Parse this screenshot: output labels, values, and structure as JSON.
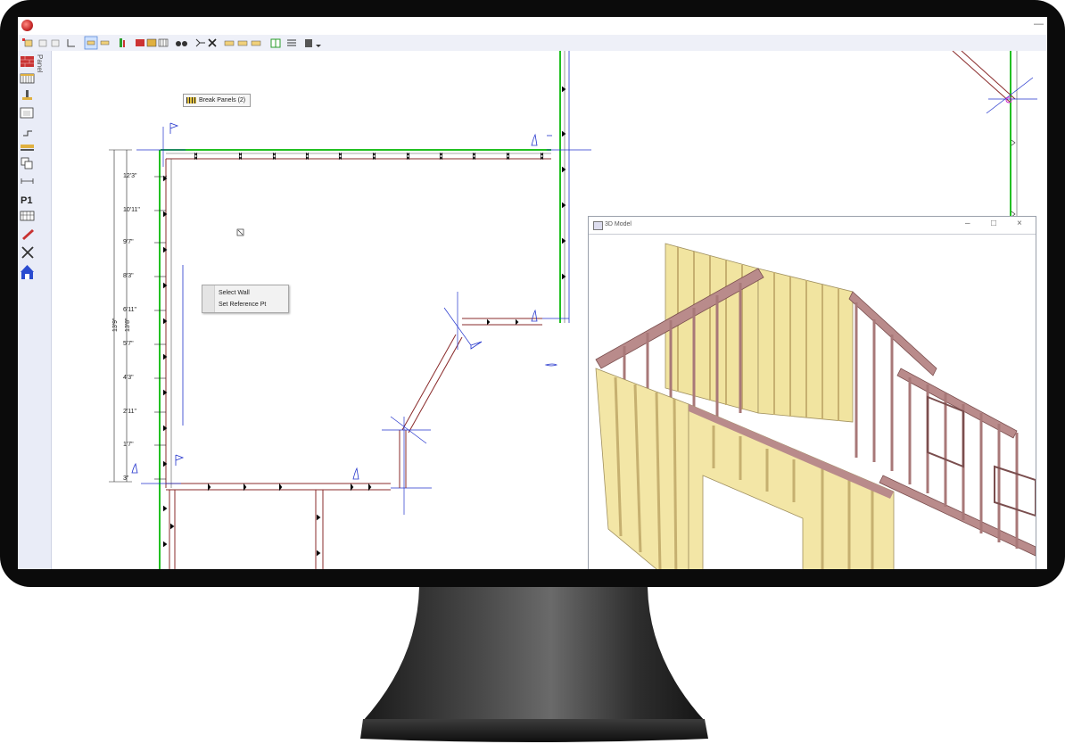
{
  "tooltip": {
    "label": "Break Panels (2)"
  },
  "left_panel": {
    "tab_label": "Panel"
  },
  "context_menu": {
    "items": [
      "Select Wall",
      "Set Reference Pt"
    ]
  },
  "model_window": {
    "title": "3D Model"
  },
  "dimensions": {
    "vertical_total_outer": "13'9\"",
    "vertical_total_inner": "13'8\"",
    "ticks": [
      "12'3\"",
      "10'11\"",
      "9'7\"",
      "8'3\"",
      "6'11\"",
      "5'7\"",
      "4'3\"",
      "2'11\"",
      "1'7\"",
      "3\""
    ]
  },
  "colors": {
    "wall_green": "#22c022",
    "wall_frame": "#8a2b2b",
    "dim_blue": "#2233cc",
    "panel_yellow": "#f1e4a0",
    "frame_pink": "#b98b8b"
  },
  "icons": [
    "wall-tool-icon",
    "break-panels-icon",
    "binoculars-icon",
    "move-icon",
    "delete-icon",
    "house-icon"
  ]
}
